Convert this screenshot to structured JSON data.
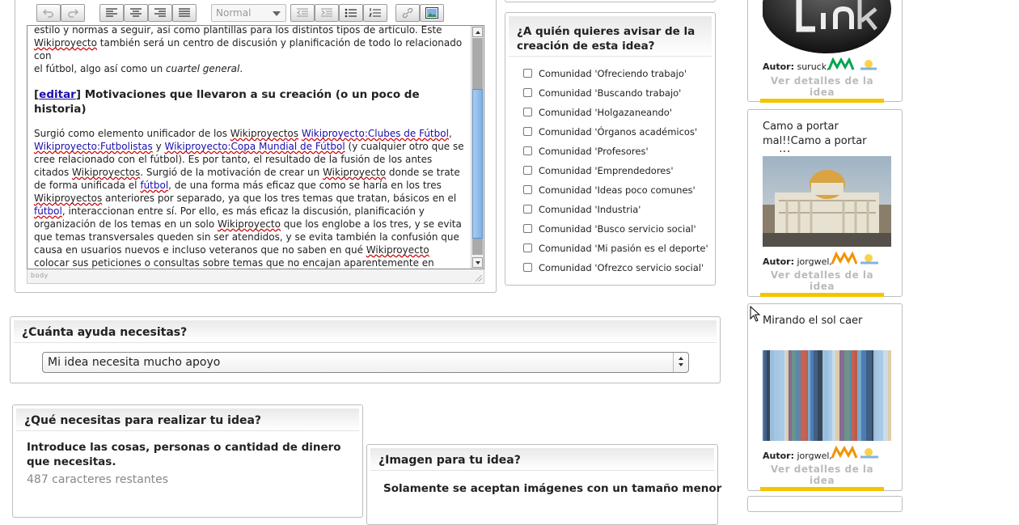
{
  "editor": {
    "toolbar_labels": {
      "undo_group": "Undo/redo",
      "align_group": "Alignment",
      "paragraph_group": "Paragraph style",
      "indent_group": "Formatting & lists",
      "insert_group": "Insert/link"
    },
    "paragraph_style_value": "Normal",
    "body": {
      "line1": "estilo y normas a seguir, así como plantillas para los distintos tipos de artículo. Este",
      "line2_a": "Wikiproyecto",
      "line2_b": " también será un centro de discusión y planificación de todo lo relacionado con",
      "line3_a": "el fútbol, algo así como un ",
      "line3_b": "cuartel general",
      "line3_c": ".",
      "heading_bracket_open": "[",
      "heading_edit": "editar",
      "heading_bracket_close": "]",
      "heading_text": " Motivaciones que llevaron a su creación (o un poco de historia)",
      "p_a": "Surgió como elemento unificador de los ",
      "p_b": "Wikiproyectos",
      "p_c": " ",
      "p_d": "Wikiproyecto:Clubes de Fútbol",
      "p_e": ", ",
      "p_f": "Wikiproyecto:Futbolistas",
      "p_g": " y ",
      "p_h": "Wikiproyecto:Copa Mundial de Fútbol",
      "p_i": " (y cualquier otro que se cree relacionado con el fútbol). Es por tanto, el resultado de la fusión de los antes citados ",
      "p_j": "Wikiproyectos",
      "p_k": ". Surgió de la motivación de crear un ",
      "p_l": "Wikiproyecto",
      "p_m": " donde se trate de forma unificada el ",
      "p_n": "fútbol",
      "p_o": ", de una forma más eficaz que como se haría en los tres ",
      "p_p": "Wikiproyectos",
      "p_q": " anteriores por separado, ya que los tres temas que tratan, básicos en el ",
      "p_r": "fútbol",
      "p_s": ", interaccionan entre sí. Por ello, es más eficaz la discusión, planificación y organización de los temas en un solo ",
      "p_t": "Wikiproyecto",
      "p_u": " que los englobe a los tres, y se evita que temas transversales queden sin ser atendidos, y se evita también la confusión que causa en usuarios nuevos e incluso veteranos que no saben en qué ",
      "p_v": "Wikiproyecto",
      "p_w": " colocar sus peticiones o consultas sobre temas que no encajan aparentemente en ninguno de los actuales."
    },
    "status_path": "body"
  },
  "notify": {
    "title": "¿A quién quieres avisar de la creación de esta idea?",
    "communities": [
      "Comunidad 'Ofreciendo trabajo'",
      "Comunidad 'Buscando trabajo'",
      "Comunidad 'Holgazaneando'",
      "Comunidad 'Órganos académicos'",
      "Comunidad 'Profesores'",
      "Comunidad 'Emprendedores'",
      "Comunidad 'Ideas poco comunes'",
      "Comunidad 'Industria'",
      "Comunidad 'Busco servicio social'",
      "Comunidad 'Mi pasión es el deporte'",
      "Comunidad 'Ofrezco servicio social'"
    ]
  },
  "help": {
    "title": "¿Cuánta ayuda necesitas?",
    "select_value": "Mi idea necesita mucho apoyo"
  },
  "needs": {
    "title": "¿Qué necesitas para realizar tu idea?",
    "instruction": "Introduce las cosas, personas o cantidad de dinero que necesitas.",
    "remaining": "487 caracteres restantes"
  },
  "image_section": {
    "title": "¿Imagen para tu idea?",
    "instruction": "Solamente se aceptan imágenes con un tamaño menor"
  },
  "ideas": [
    {
      "title": "",
      "author_label": "Autor:",
      "author": "suruck,",
      "details": "Ver detalles de la idea",
      "image": "link-logo-image"
    },
    {
      "title": "Camo a portar mal!!Camo a portar mal!!",
      "author_label": "Autor:",
      "author": "jorgwel,",
      "details": "Ver detalles de la idea",
      "image": "palace-photo-image"
    },
    {
      "title": "Mirando el sol caer",
      "author_label": "Autor:",
      "author": "jorgwel,",
      "details": "Ver detalles de la idea",
      "image": "abstract-stripes-image"
    }
  ],
  "colors": {
    "link": "#1a0dab",
    "accent_underline": "#f5c400",
    "logo_orange": "#f39200",
    "logo_green": "#00a651"
  }
}
